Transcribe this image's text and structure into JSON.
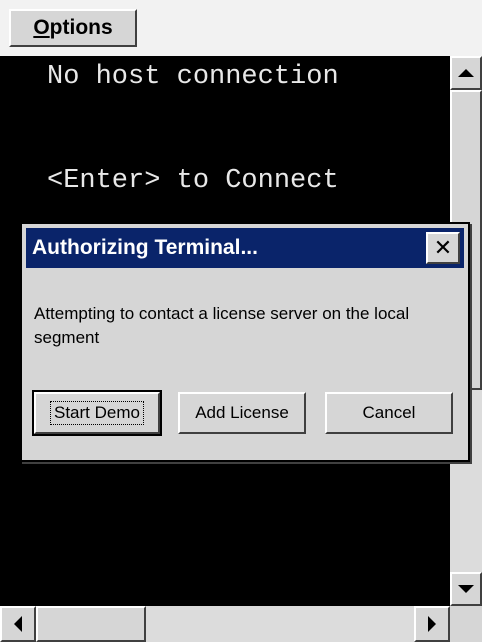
{
  "menu": {
    "options_label": "Options",
    "options_mnemonic": "O",
    "options_rest": "ptions"
  },
  "terminal": {
    "line1": "No host connection",
    "line2": "<Enter> to Connect"
  },
  "dialog": {
    "title": "Authorizing Terminal...",
    "close_glyph": "✕",
    "message": "Attempting to contact a license server on the local segment",
    "buttons": {
      "start_demo": "Start Demo",
      "add_license": "Add License",
      "cancel": "Cancel"
    }
  },
  "icons": {
    "scroll_up": "arrow-up-icon",
    "scroll_down": "arrow-down-icon",
    "scroll_left": "arrow-left-icon",
    "scroll_right": "arrow-right-icon",
    "close": "close-icon"
  },
  "colors": {
    "terminal_bg": "#000000",
    "terminal_text": "#e8e8e8",
    "titlebar": "#0a246a",
    "chrome": "#d6d6d6"
  }
}
